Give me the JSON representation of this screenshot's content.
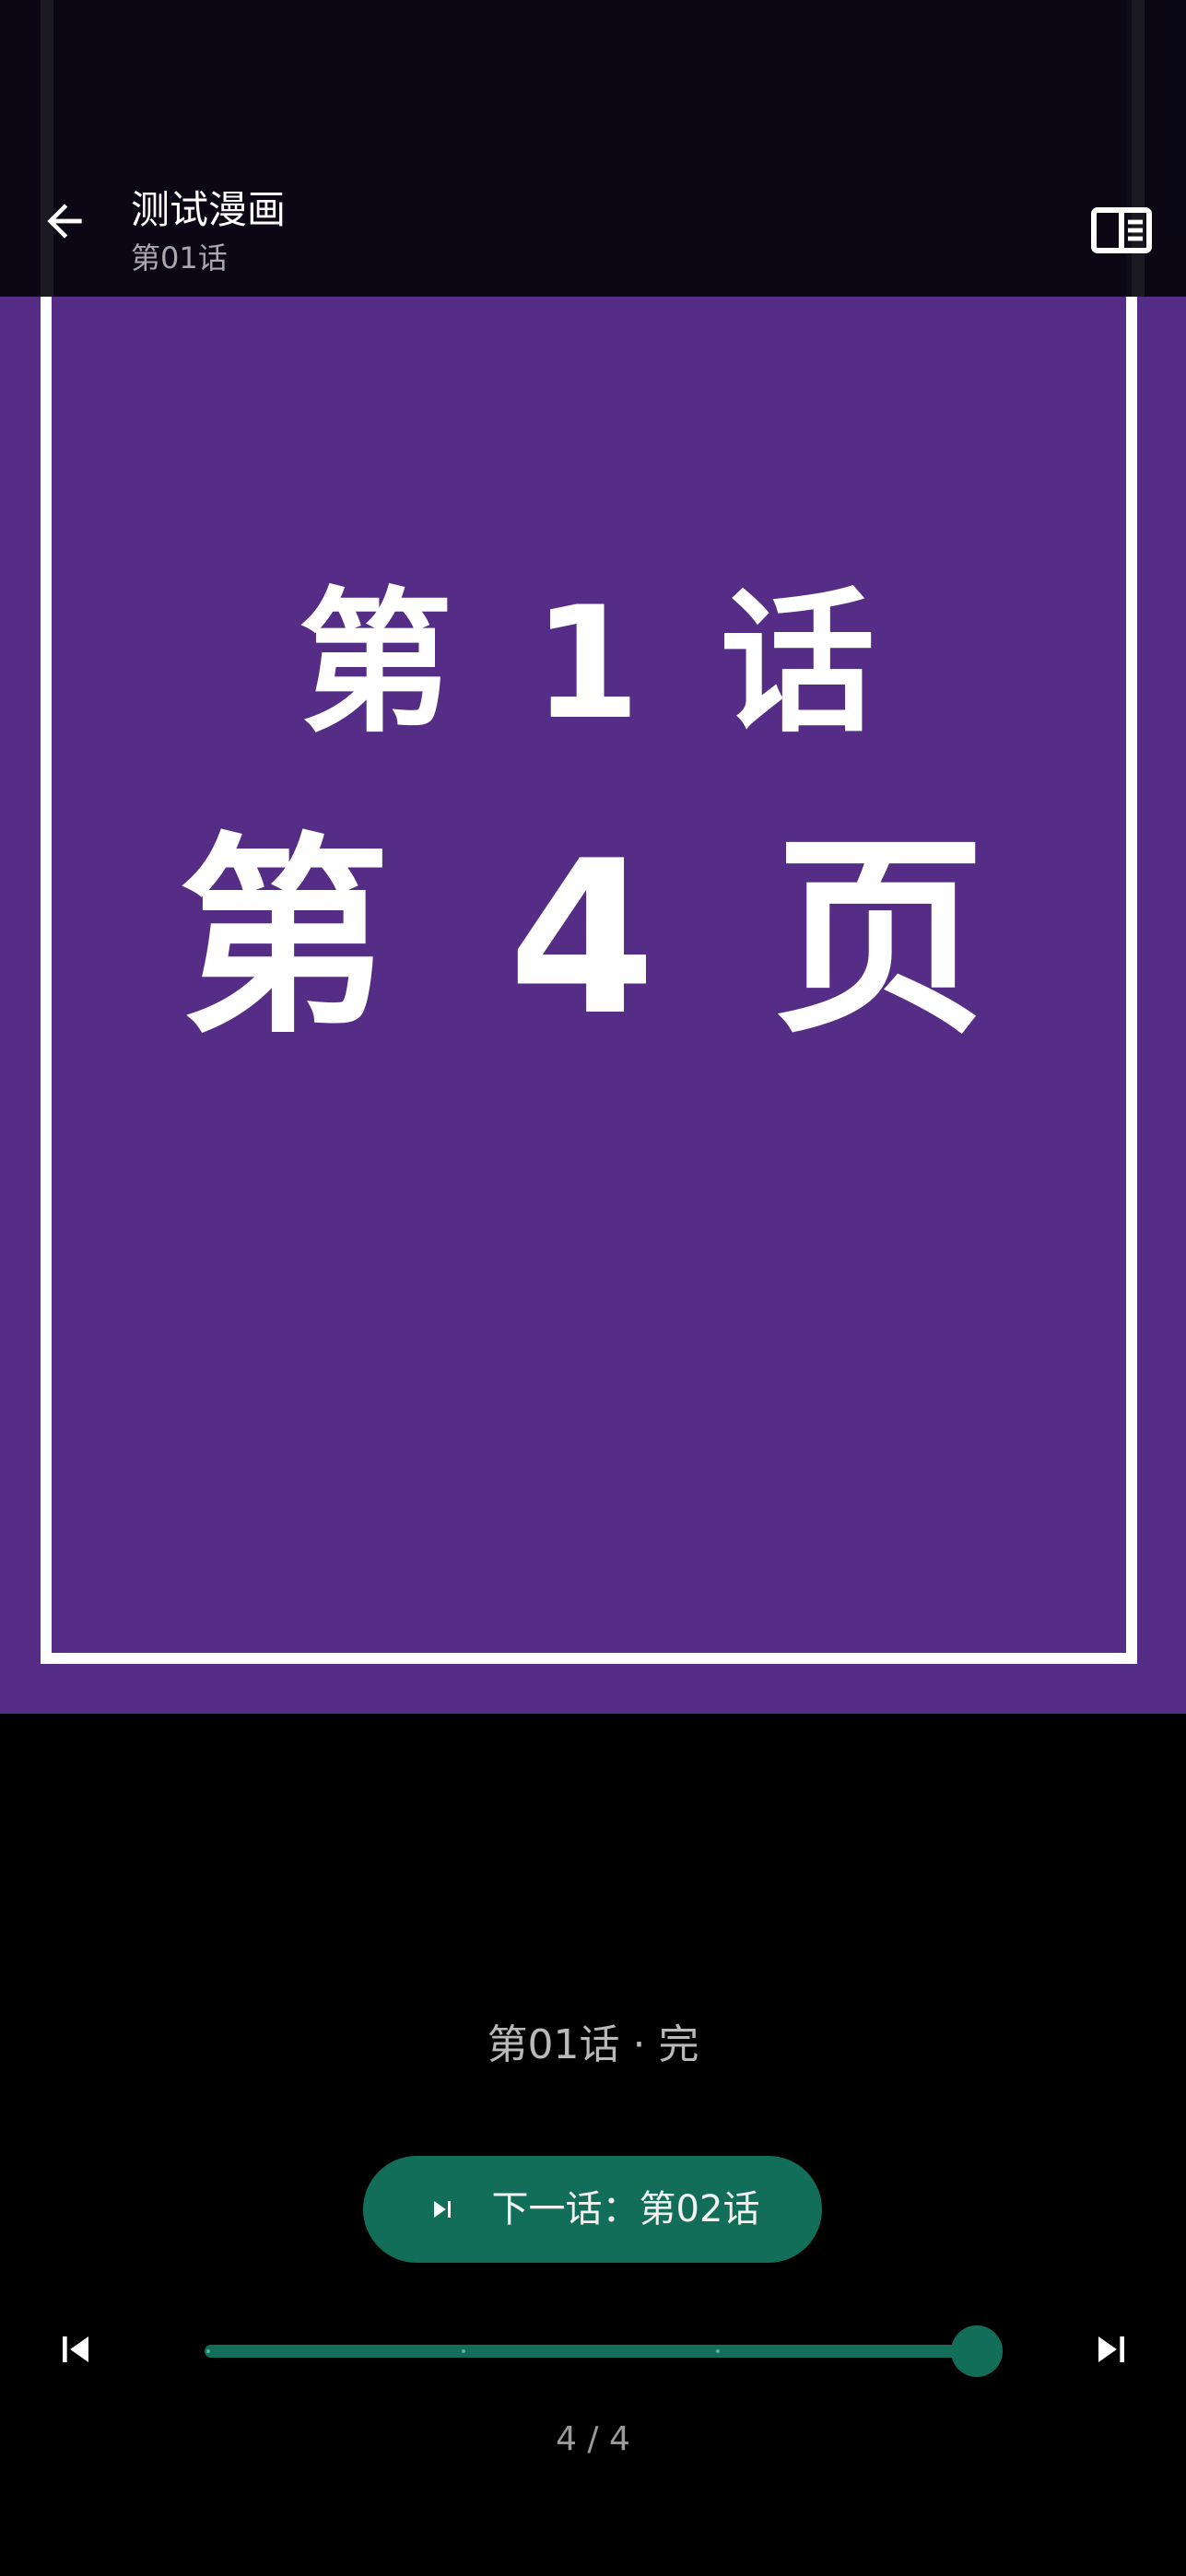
{
  "reader": {
    "page_text": {
      "line1": "第 1 话",
      "line2": "第 4 页"
    },
    "page_background": "#562D86"
  },
  "header": {
    "title": "测试漫画",
    "subtitle": "第01话",
    "back_icon": "arrow-left-icon",
    "mode_icon": "reading-mode-icon"
  },
  "footer": {
    "chapter_end": "第01话 · 完",
    "next_chapter_label": "下一话：第02话",
    "prev_chapter_icon": "skip-previous-icon",
    "next_chapter_icon": "skip-next-icon",
    "page_indicator": "4 / 4",
    "progress": {
      "current_page": 4,
      "total_pages": 4
    },
    "accent_color": "#136E59"
  }
}
